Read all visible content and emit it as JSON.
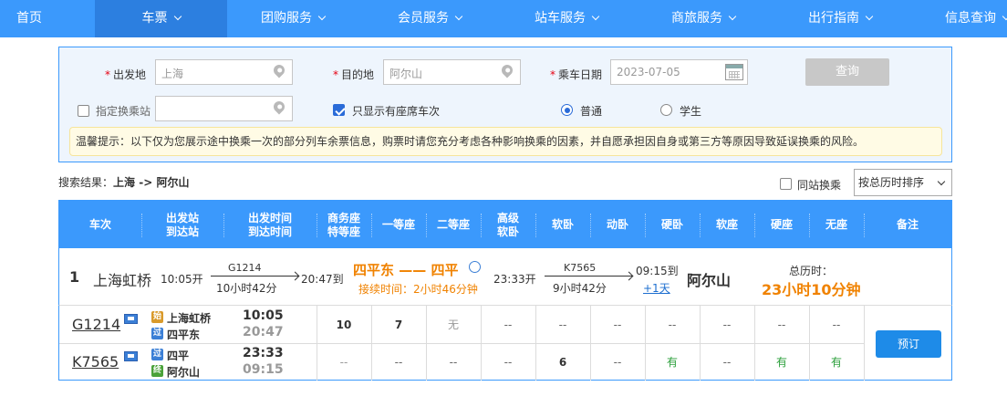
{
  "nav": {
    "items": [
      {
        "label": "首页",
        "dropdown": false
      },
      {
        "label": "车票",
        "dropdown": true
      },
      {
        "label": "团购服务",
        "dropdown": true
      },
      {
        "label": "会员服务",
        "dropdown": true
      },
      {
        "label": "站车服务",
        "dropdown": true
      },
      {
        "label": "商旅服务",
        "dropdown": true
      },
      {
        "label": "出行指南",
        "dropdown": true
      },
      {
        "label": "信息查询",
        "dropdown": true
      }
    ],
    "active_index": 1
  },
  "search": {
    "from_label": "出发地",
    "from_value": "上海",
    "to_label": "目的地",
    "to_value": "阿尔山",
    "date_label": "乘车日期",
    "date_value": "2023-07-05",
    "query_label": "查询",
    "transfer_label": "指定换乘站",
    "transfer_checked": false,
    "seat_only_label": "只显示有座席车次",
    "seat_only_checked": true,
    "ticket_type_normal": "普通",
    "ticket_type_student": "学生",
    "ticket_type_selected": "普通",
    "tip": "温馨提示：以下仅为您展示途中换乘一次的部分列车余票信息，购票时请您充分考虑各种影响换乘的因素，并自愿承担因自身或第三方等原因导致延误换乘的风险。"
  },
  "results": {
    "label": "搜索结果：",
    "from": "上海",
    "arrow": "->",
    "to": "阿尔山",
    "same_station_label": "同站换乘",
    "same_station_checked": false,
    "sort_value": "按总历时排序"
  },
  "table": {
    "headers": {
      "train": "车次",
      "stations_1": "出发站",
      "stations_2": "到达站",
      "times_1": "出发时间",
      "times_2": "到达时间",
      "business_1": "商务座",
      "business_2": "特等座",
      "first": "一等座",
      "second": "二等座",
      "premium_1": "高级",
      "premium_2": "软卧",
      "soft_sleeper": "软卧",
      "emu_sleeper": "动卧",
      "hard_sleeper": "硬卧",
      "soft_seat": "软座",
      "hard_seat": "硬座",
      "no_seat": "无座",
      "remark": "备注"
    },
    "summary": {
      "index": "1",
      "origin": "上海虹桥",
      "dep_time": "10:05开",
      "leg1_train": "G1214",
      "leg1_duration": "10小时42分",
      "leg1_arr": "20:47到",
      "transfer_from": "四平东",
      "transfer_dash": "——",
      "transfer_to": "四平",
      "transfer_wait": "接续时间：2小时46分钟",
      "leg2_dep": "23:33开",
      "leg2_train": "K7565",
      "leg2_duration": "9小时42分",
      "leg2_arr": "09:15到",
      "plus_day": "+1天",
      "destination": "阿尔山",
      "total_label": "总历时：",
      "total_value": "23小时10分钟"
    },
    "rows": [
      {
        "train": "G1214",
        "from_badge": "始",
        "from": "上海虹桥",
        "to_badge": "过",
        "to": "四平东",
        "dep": "10:05",
        "arr": "20:47",
        "business": "10",
        "first": "7",
        "second": "无",
        "premium": "--",
        "soft_sleeper": "--",
        "emu_sleeper": "--",
        "hard_sleeper": "--",
        "soft_seat": "--",
        "hard_seat": "--",
        "no_seat": "--"
      },
      {
        "train": "K7565",
        "from_badge": "过",
        "from": "四平",
        "to_badge": "终",
        "to": "阿尔山",
        "dep": "23:33",
        "arr": "09:15",
        "business": "--",
        "first": "--",
        "second": "--",
        "premium": "--",
        "soft_sleeper": "6",
        "emu_sleeper": "--",
        "hard_sleeper": "有",
        "soft_seat": "--",
        "hard_seat": "有",
        "no_seat": "有"
      }
    ],
    "book_label": "预订"
  },
  "colors": {
    "nav_bg": "#3b99fc",
    "accent_orange": "#f08200",
    "available_green": "#2b9f3b",
    "book_button": "#1e8be8"
  }
}
